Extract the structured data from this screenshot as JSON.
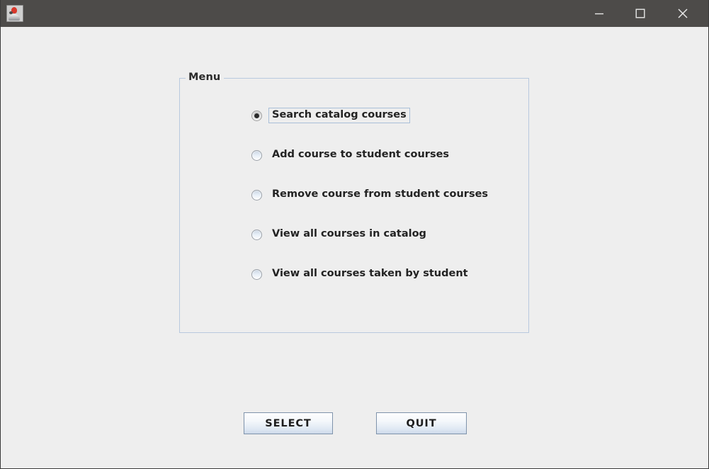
{
  "window": {
    "title": "",
    "icon": "java-duke-icon",
    "background_color": "#eeeeee",
    "titlebar_color": "#4d4b49",
    "controls": {
      "minimize_label": "Minimize",
      "maximize_label": "Maximize",
      "close_label": "Close"
    }
  },
  "panel": {
    "legend": "Menu",
    "border_color": "#b8c9de"
  },
  "menu": {
    "options": [
      {
        "label": "Search catalog courses",
        "selected": true,
        "focused": true
      },
      {
        "label": "Add course to student courses",
        "selected": false,
        "focused": false
      },
      {
        "label": "Remove course from student courses",
        "selected": false,
        "focused": false
      },
      {
        "label": "View all courses in catalog",
        "selected": false,
        "focused": false
      },
      {
        "label": "View all courses taken by student",
        "selected": false,
        "focused": false
      }
    ]
  },
  "buttons": {
    "select_label": "SELECT",
    "quit_label": "QUIT"
  }
}
